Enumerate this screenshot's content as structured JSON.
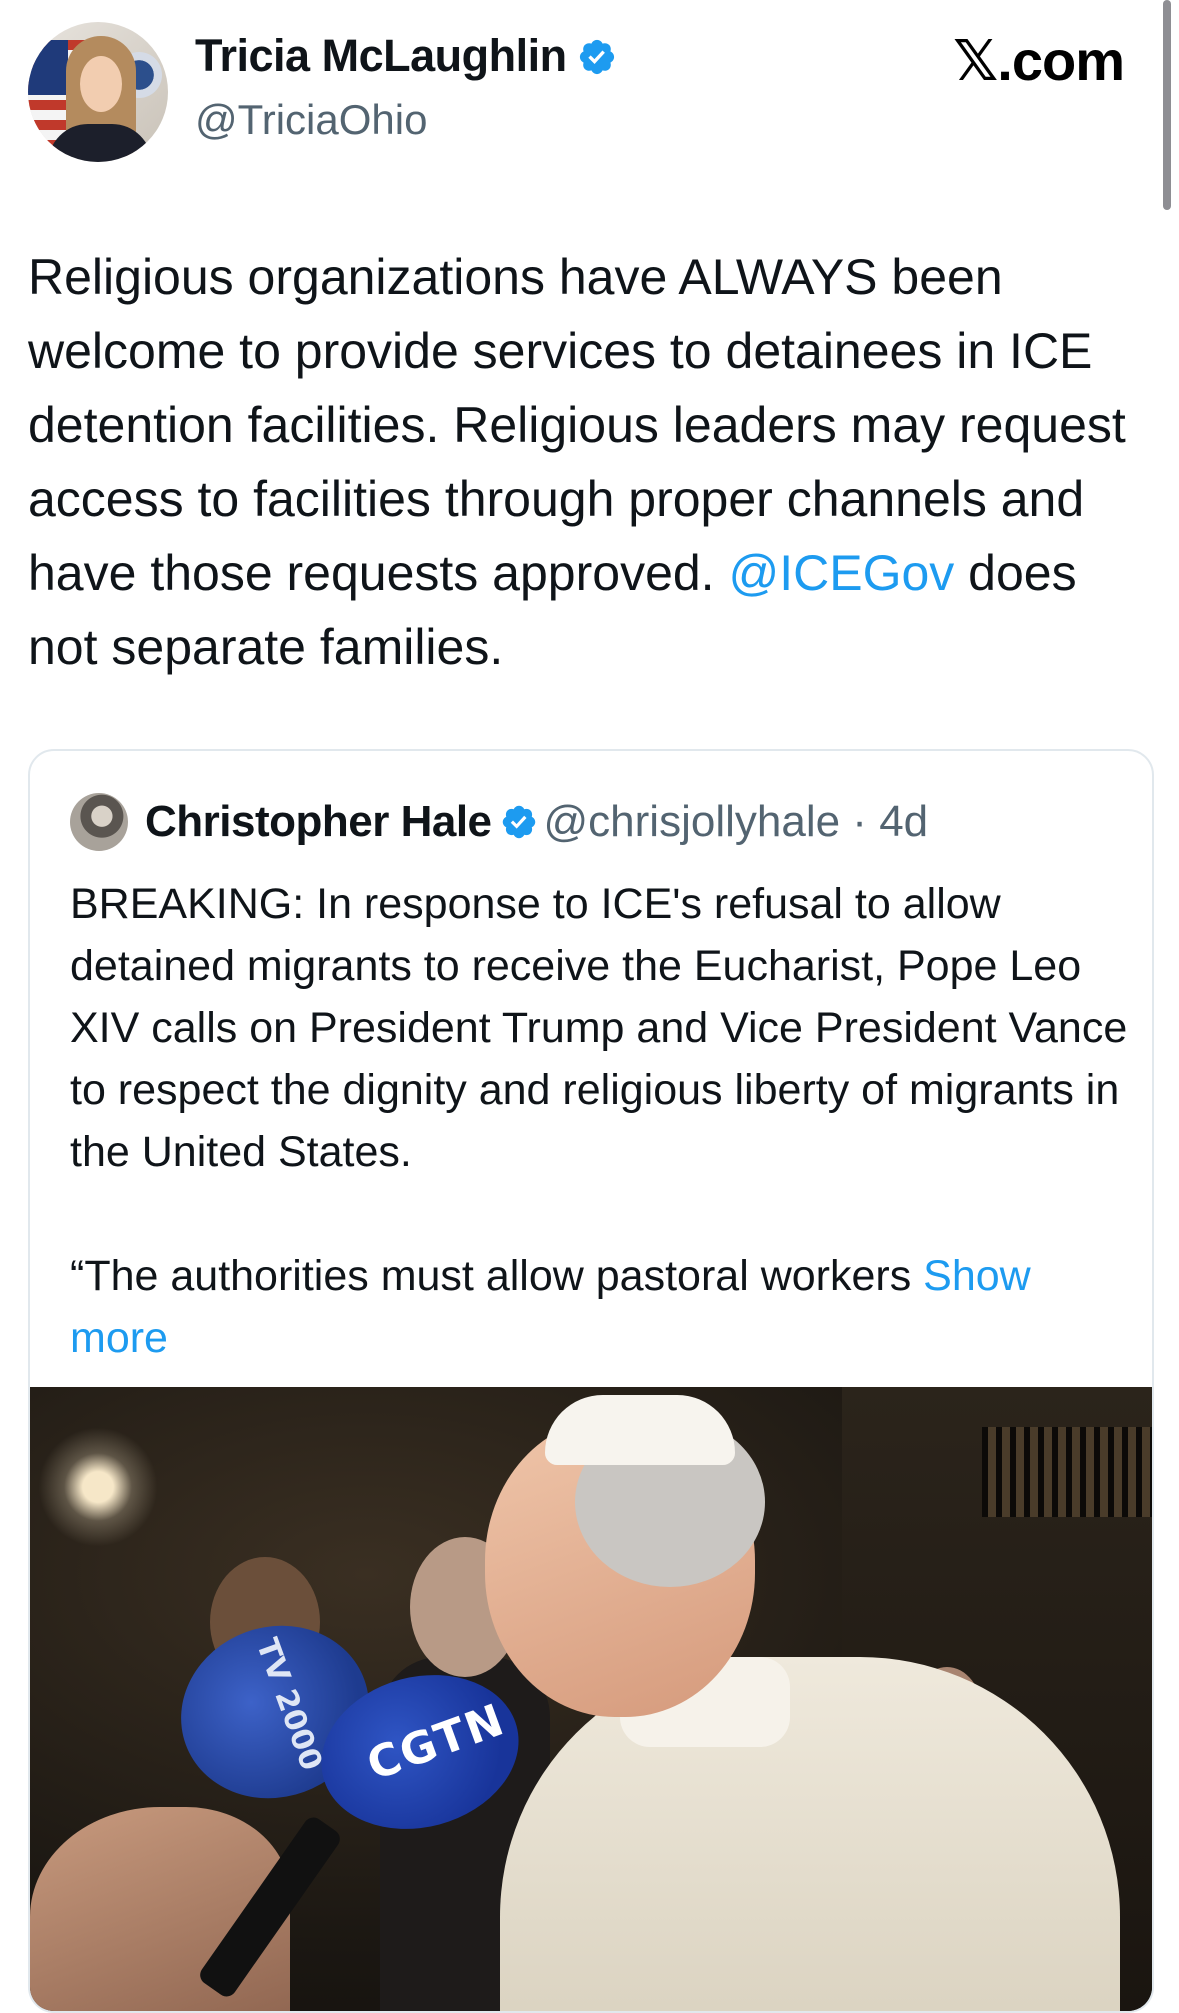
{
  "header": {
    "author_name": "Tricia McLaughlin",
    "author_handle": "@TriciaOhio",
    "source": "𝕏.com",
    "verified_color": "#1d9bf0"
  },
  "tweet": {
    "text_before": "Religious organizations have ALWAYS been welcome to provide services to detainees in ICE detention facilities. Religious leaders may request access to facilities through proper channels and have those requests approved. ",
    "mention": "@ICEGov",
    "text_after": " does not separate families."
  },
  "quote": {
    "author_name": "Christopher Hale",
    "author_handle": "@chrisjollyhale",
    "separator": " · ",
    "age": "4d",
    "paragraph1": "BREAKING: In response to ICE's refusal to allow detained migrants to receive the Eucharist, Pope Leo XIV calls on President Trump and Vice President Vance to respect the dignity and religious liberty of migrants in the United States.",
    "paragraph2": "“The authorities must allow pastoral workers ",
    "show_more": "Show more",
    "image": {
      "mic1_label": "TV 2000",
      "mic2_label": "CGTN"
    }
  },
  "colors": {
    "link": "#1d9bf0",
    "secondary_text": "#536471",
    "primary_text": "#0f1419",
    "card_border": "#e1e8ed"
  }
}
